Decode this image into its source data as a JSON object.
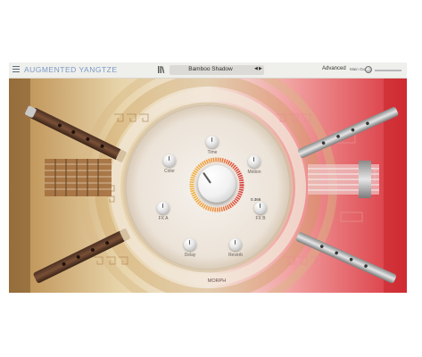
{
  "app": {
    "title": "AUGMENTED YANGTZE"
  },
  "header": {
    "preset_name": "Bamboo Shadow",
    "advanced_label": "Advanced",
    "master_gain_label": "Main Out"
  },
  "knobs": {
    "time": "Time",
    "color": "Color",
    "motion": "Motion",
    "fx_a": "FX A",
    "fx_b": "FX B",
    "delay": "Delay",
    "reverb": "Reverb",
    "morph": "MORPH"
  },
  "readouts": {
    "fx_b_value": "0.366"
  },
  "colors": {
    "accent_blue": "#7a99c6",
    "left_theme": "#c89a55",
    "right_theme": "#e23f44",
    "morph_ring_start": "#f0a030",
    "morph_ring_end": "#d83a3a"
  },
  "icons": {
    "menu": "hamburger-menu-icon",
    "preset_browser": "library-icon",
    "prev": "triangle-left-icon",
    "next": "triangle-right-icon",
    "master_knob": "knob-icon"
  }
}
